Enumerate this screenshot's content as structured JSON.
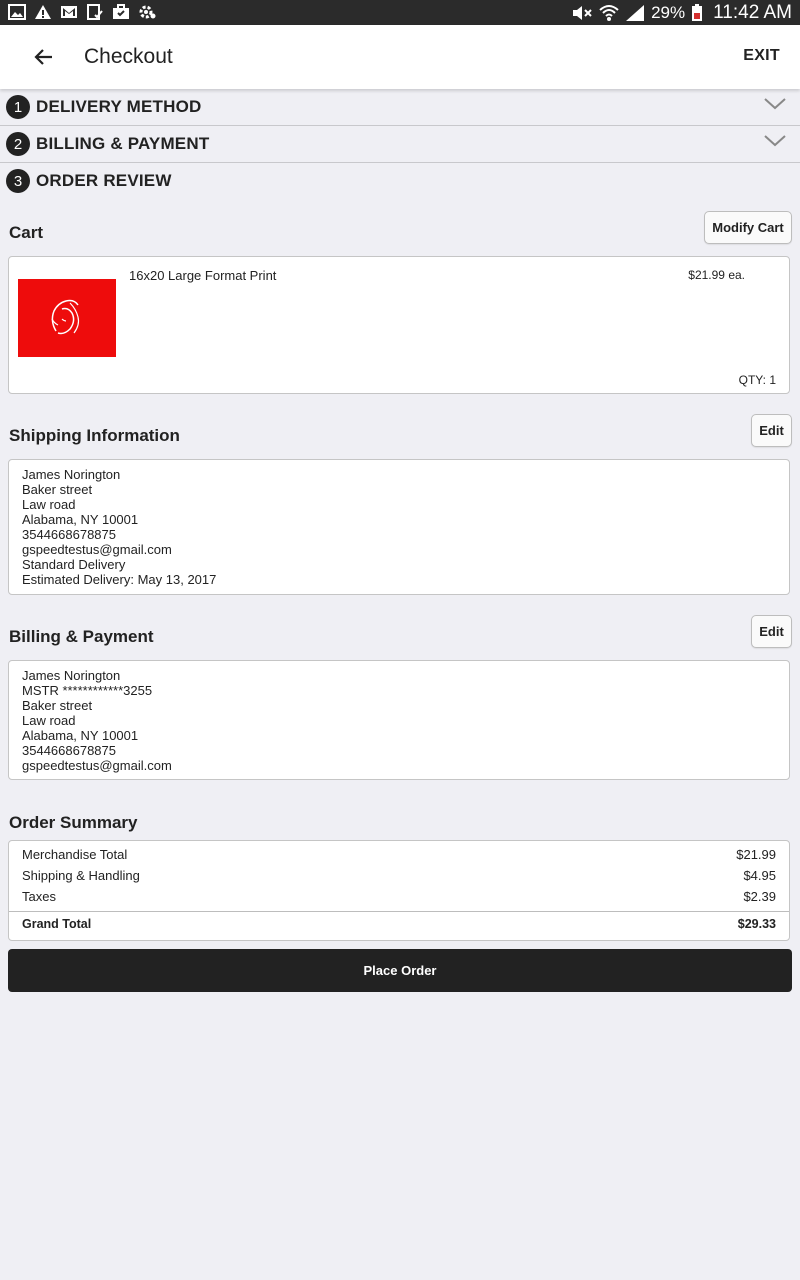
{
  "status_bar": {
    "battery": "29%",
    "time": "11:42 AM",
    "icons": [
      "image-icon",
      "warning-icon",
      "gmail-icon",
      "task-icon",
      "briefcase-icon",
      "settings-badge-icon"
    ]
  },
  "app_bar": {
    "title": "Checkout",
    "exit_label": "EXIT"
  },
  "steps": [
    {
      "number": "1",
      "label": "DELIVERY METHOD"
    },
    {
      "number": "2",
      "label": "BILLING & PAYMENT"
    },
    {
      "number": "3",
      "label": "ORDER REVIEW"
    }
  ],
  "cart": {
    "title": "Cart",
    "modify_label": "Modify Cart",
    "item": {
      "name": "16x20 Large Format Print",
      "price": "$21.99 ea.",
      "qty": "QTY: 1",
      "thumb_color": "#ee0c0c"
    }
  },
  "shipping": {
    "title": "Shipping Information",
    "edit_label": "Edit",
    "lines": [
      "James Norington",
      "Baker street",
      "Law road",
      "Alabama, NY 10001",
      "3544668678875",
      "gspeedtestus@gmail.com",
      "Standard Delivery",
      "Estimated Delivery: May 13, 2017"
    ]
  },
  "billing": {
    "title": "Billing & Payment",
    "edit_label": "Edit",
    "lines": [
      "James Norington",
      "MSTR ************3255",
      "Baker street",
      "Law road",
      "Alabama, NY 10001",
      "3544668678875",
      "gspeedtestus@gmail.com"
    ]
  },
  "summary": {
    "title": "Order Summary",
    "rows": [
      {
        "label": "Merchandise Total",
        "value": "$21.99"
      },
      {
        "label": "Shipping & Handling",
        "value": "$4.95"
      },
      {
        "label": "Taxes",
        "value": "$2.39"
      }
    ],
    "total_label": "Grand Total",
    "total_value": "$29.33"
  },
  "place_order_label": "Place Order"
}
